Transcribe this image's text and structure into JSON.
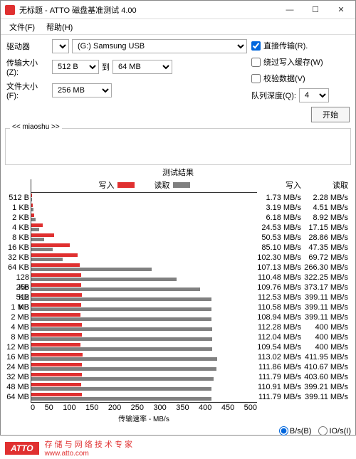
{
  "window": {
    "title": "无标题 - ATTO 磁盘基准测试 4.00"
  },
  "menu": {
    "file": "文件(F)",
    "help": "帮助(H)"
  },
  "form": {
    "drive_label": "驱动器",
    "drive_sel1": "...",
    "drive_sel2": "(G:) Samsung USB",
    "tsize_label": "传输大小(Z):",
    "tsize_from": "512 B",
    "tsize_to_label": "到",
    "tsize_to": "64 MB",
    "fsize_label": "文件大小(F):",
    "fsize": "256 MB",
    "direct": "直接传输(R).",
    "bypass": "绕过写入缓存(W)",
    "verify": "校验数据(V)",
    "qdepth_label": "队列深度(Q):",
    "qdepth": "4",
    "start": "开始"
  },
  "desc": {
    "label": "<< miaoshu >>"
  },
  "res": {
    "title": "测试结果",
    "write": "写入",
    "read": "读取",
    "xlabel": "传输速率 - MB/s",
    "unit": "MB/s"
  },
  "footer": {
    "bs": "B/s(B)",
    "ios": "IO/s(I)"
  },
  "atto": {
    "logo": "ATTO",
    "slogan": "存 储 与 网 络 技 术 专 家",
    "url": "www.atto.com"
  },
  "chart_data": {
    "type": "bar",
    "xlabel": "传输速率 - MB/s",
    "xlim": [
      0,
      500
    ],
    "xticks": [
      0,
      50,
      100,
      150,
      200,
      250,
      300,
      350,
      400,
      450,
      500
    ],
    "series": [
      {
        "name": "写入"
      },
      {
        "name": "读取"
      }
    ],
    "rows": [
      {
        "size": "512 B",
        "write": 1.73,
        "read": 2.28
      },
      {
        "size": "1 KB",
        "write": 3.19,
        "read": 4.51
      },
      {
        "size": "2 KB",
        "write": 6.18,
        "read": 8.92
      },
      {
        "size": "4 KB",
        "write": 24.53,
        "read": 17.15
      },
      {
        "size": "8 KB",
        "write": 50.53,
        "read": 28.86
      },
      {
        "size": "16 KB",
        "write": 85.1,
        "read": 47.35
      },
      {
        "size": "32 KB",
        "write": 102.3,
        "read": 69.72
      },
      {
        "size": "64 KB",
        "write": 107.13,
        "read": 266.3
      },
      {
        "size": "128 KB",
        "write": 110.48,
        "read": 322.25
      },
      {
        "size": "256 KB",
        "write": 109.76,
        "read": 373.17
      },
      {
        "size": "512 KB",
        "write": 112.53,
        "read": 399.11
      },
      {
        "size": "1 MB",
        "write": 110.58,
        "read": 399.11
      },
      {
        "size": "2 MB",
        "write": 108.94,
        "read": 399.11
      },
      {
        "size": "4 MB",
        "write": 112.28,
        "read": 400
      },
      {
        "size": "8 MB",
        "write": 112.04,
        "read": 400
      },
      {
        "size": "12 MB",
        "write": 109.54,
        "read": 400
      },
      {
        "size": "16 MB",
        "write": 113.02,
        "read": 411.95
      },
      {
        "size": "24 MB",
        "write": 111.86,
        "read": 410.67
      },
      {
        "size": "32 MB",
        "write": 111.79,
        "read": 403.6
      },
      {
        "size": "48 MB",
        "write": 110.91,
        "read": 399.21
      },
      {
        "size": "64 MB",
        "write": 111.79,
        "read": 399.11
      }
    ]
  }
}
